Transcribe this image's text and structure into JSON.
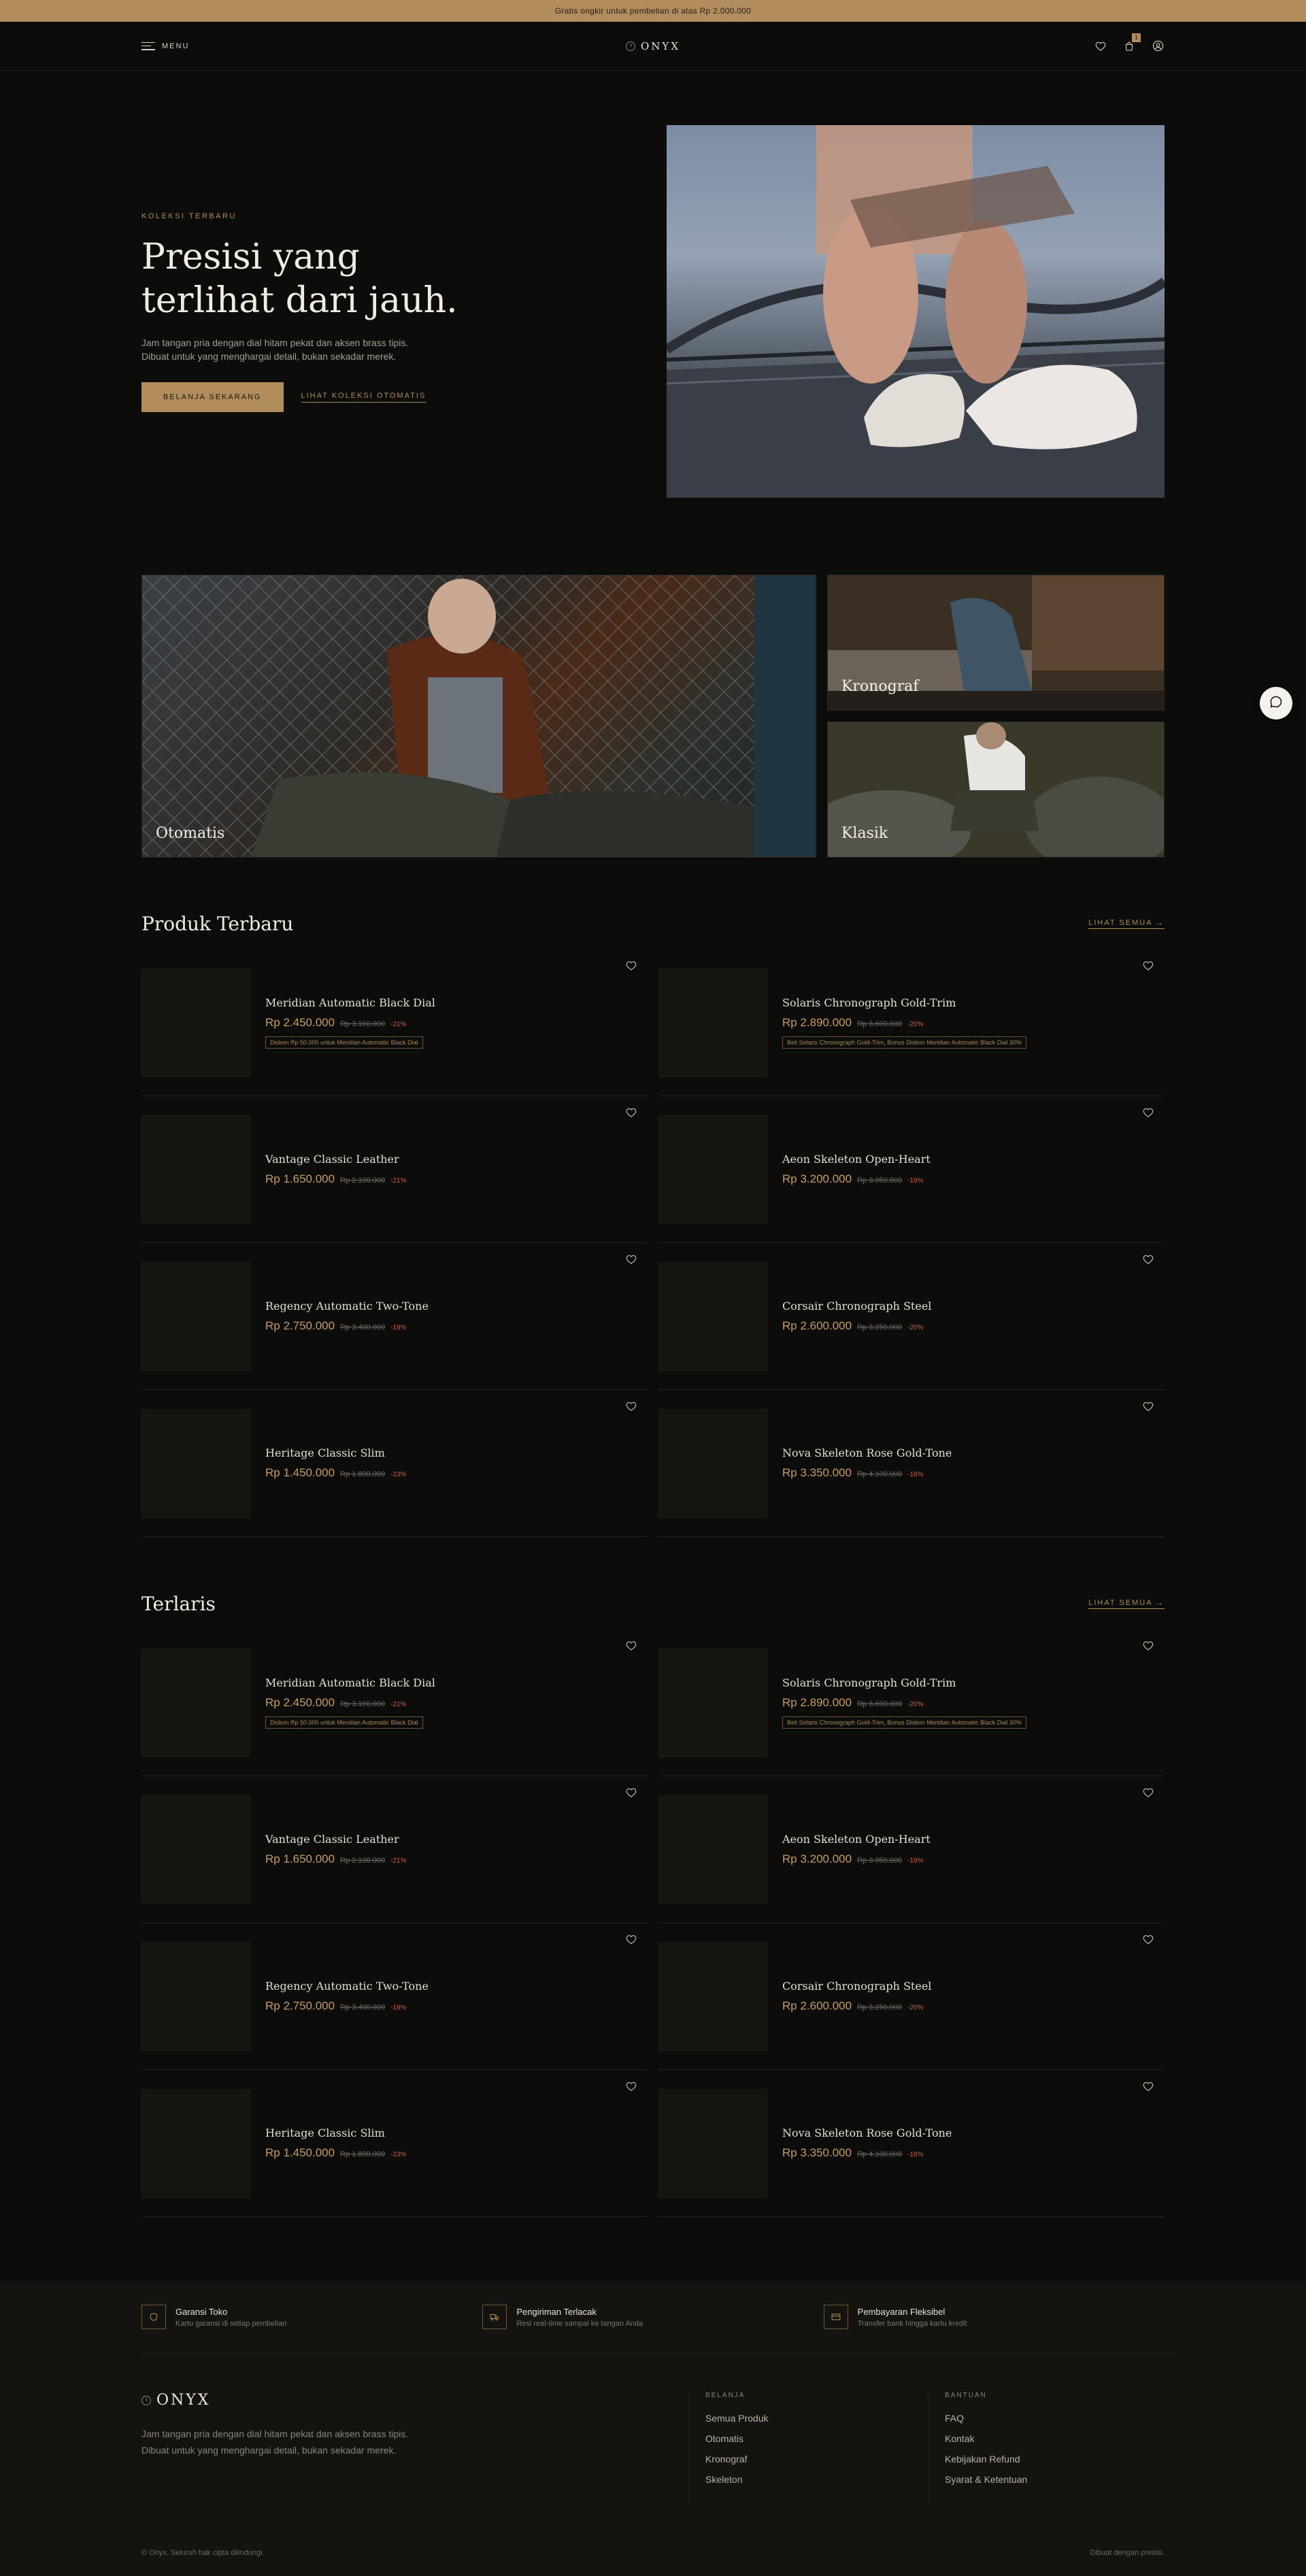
{
  "announcement": "Gratis ongkir untuk pembelian di atas Rp 2.000.000",
  "header": {
    "menu_label": "MENU",
    "brand": "ONYX",
    "cart_count": "1"
  },
  "hero": {
    "eyebrow": "KOLEKSI TERBARU",
    "title_line1": "Presisi yang",
    "title_line2": "terlihat dari jauh.",
    "subtitle": "Jam tangan pria dengan dial hitam pekat dan aksen brass tipis. Dibuat untuk yang menghargai detail, bukan sekadar merek.",
    "cta_primary": "BELANJA SEKARANG",
    "cta_secondary": "LIHAT KOLEKSI OTOMATIS"
  },
  "categories": [
    {
      "label": "Otomatis"
    },
    {
      "label": "Kronograf"
    },
    {
      "label": "Klasik"
    }
  ],
  "sections": [
    {
      "title": "Produk Terbaru",
      "see_all": "LIHAT SEMUA →",
      "products": [
        {
          "name": "Meridian Automatic Black Dial",
          "price": "Rp 2.450.000",
          "old": "Rp 3.100.000",
          "disc": "-21%",
          "promo": "Diskon Rp 50.000 untuk Meridian Automatic Black Dial"
        },
        {
          "name": "Solaris Chronograph Gold-Trim",
          "price": "Rp 2.890.000",
          "old": "Rp 3.600.000",
          "disc": "-20%",
          "promo": "Beli Solaris Chronograph Gold-Trim, Bonus Diskon Meridian Automatic Black Dial 30%"
        },
        {
          "name": "Vantage Classic Leather",
          "price": "Rp 1.650.000",
          "old": "Rp 2.100.000",
          "disc": "-21%",
          "promo": ""
        },
        {
          "name": "Aeon Skeleton Open-Heart",
          "price": "Rp 3.200.000",
          "old": "Rp 3.950.000",
          "disc": "-19%",
          "promo": ""
        },
        {
          "name": "Regency Automatic Two-Tone",
          "price": "Rp 2.750.000",
          "old": "Rp 3.400.000",
          "disc": "-19%",
          "promo": ""
        },
        {
          "name": "Corsair Chronograph Steel",
          "price": "Rp 2.600.000",
          "old": "Rp 3.250.000",
          "disc": "-20%",
          "promo": ""
        },
        {
          "name": "Heritage Classic Slim",
          "price": "Rp 1.450.000",
          "old": "Rp 1.890.000",
          "disc": "-23%",
          "promo": ""
        },
        {
          "name": "Nova Skeleton Rose Gold-Tone",
          "price": "Rp 3.350.000",
          "old": "Rp 4.100.000",
          "disc": "-18%",
          "promo": ""
        }
      ]
    },
    {
      "title": "Terlaris",
      "see_all": "LIHAT SEMUA →",
      "products": [
        {
          "name": "Meridian Automatic Black Dial",
          "price": "Rp 2.450.000",
          "old": "Rp 3.100.000",
          "disc": "-21%",
          "promo": "Diskon Rp 50.000 untuk Meridian Automatic Black Dial"
        },
        {
          "name": "Solaris Chronograph Gold-Trim",
          "price": "Rp 2.890.000",
          "old": "Rp 3.600.000",
          "disc": "-20%",
          "promo": "Beli Solaris Chronograph Gold-Trim, Bonus Diskon Meridian Automatic Black Dial 30%"
        },
        {
          "name": "Vantage Classic Leather",
          "price": "Rp 1.650.000",
          "old": "Rp 2.100.000",
          "disc": "-21%",
          "promo": ""
        },
        {
          "name": "Aeon Skeleton Open-Heart",
          "price": "Rp 3.200.000",
          "old": "Rp 3.950.000",
          "disc": "-19%",
          "promo": ""
        },
        {
          "name": "Regency Automatic Two-Tone",
          "price": "Rp 2.750.000",
          "old": "Rp 3.400.000",
          "disc": "-19%",
          "promo": ""
        },
        {
          "name": "Corsair Chronograph Steel",
          "price": "Rp 2.600.000",
          "old": "Rp 3.250.000",
          "disc": "-20%",
          "promo": ""
        },
        {
          "name": "Heritage Classic Slim",
          "price": "Rp 1.450.000",
          "old": "Rp 1.890.000",
          "disc": "-23%",
          "promo": ""
        },
        {
          "name": "Nova Skeleton Rose Gold-Tone",
          "price": "Rp 3.350.000",
          "old": "Rp 4.100.000",
          "disc": "-18%",
          "promo": ""
        }
      ]
    }
  ],
  "footer": {
    "features": [
      {
        "title": "Garansi Toko",
        "sub": "Kartu garansi di setiap pembelian",
        "icon": "shield-icon"
      },
      {
        "title": "Pengiriman Terlacak",
        "sub": "Resi real-time sampai ke tangan Anda",
        "icon": "truck-icon"
      },
      {
        "title": "Pembayaran Fleksibel",
        "sub": "Transfer bank hingga kartu kredit",
        "icon": "card-icon"
      }
    ],
    "brand": "ONYX",
    "description": "Jam tangan pria dengan dial hitam pekat dan aksen brass tipis. Dibuat untuk yang menghargai detail, bukan sekadar merek.",
    "columns": [
      {
        "heading": "BELANJA",
        "links": [
          "Semua Produk",
          "Otomatis",
          "Kronograf",
          "Skeleton"
        ]
      },
      {
        "heading": "BANTUAN",
        "links": [
          "FAQ",
          "Kontak",
          "Kebijakan Refund",
          "Syarat & Ketentuan"
        ]
      }
    ],
    "copyright": "© Onyx. Seluruh hak cipta dilindungi.",
    "made": "Dibuat dengan presisi."
  },
  "colors": {
    "accent": "#b18c5d",
    "background": "#0c0c0b",
    "discount": "#d05a3e"
  }
}
